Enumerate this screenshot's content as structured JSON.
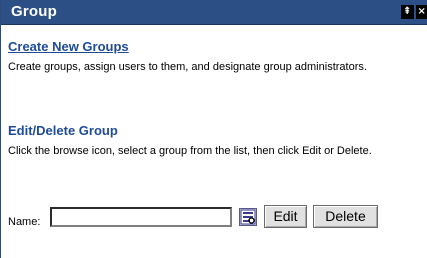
{
  "header": {
    "title": "Group",
    "controls": [
      {
        "icon": "pin-icon",
        "glyph": "⇞"
      },
      {
        "icon": "close-icon",
        "glyph": "×"
      }
    ]
  },
  "create_section": {
    "title": "Create New Groups",
    "description": "Create groups, assign users to them, and designate group administrators."
  },
  "edit_section": {
    "title": "Edit/Delete Group",
    "description": "Click the browse icon, select a group from the list, then click Edit or Delete."
  },
  "form": {
    "name_label": "Name:",
    "name_value": "",
    "browse_icon": "browse-icon",
    "edit_label": "Edit",
    "delete_label": "Delete"
  },
  "colors": {
    "title_bar": "#2c4f86",
    "link": "#1f4c97"
  }
}
